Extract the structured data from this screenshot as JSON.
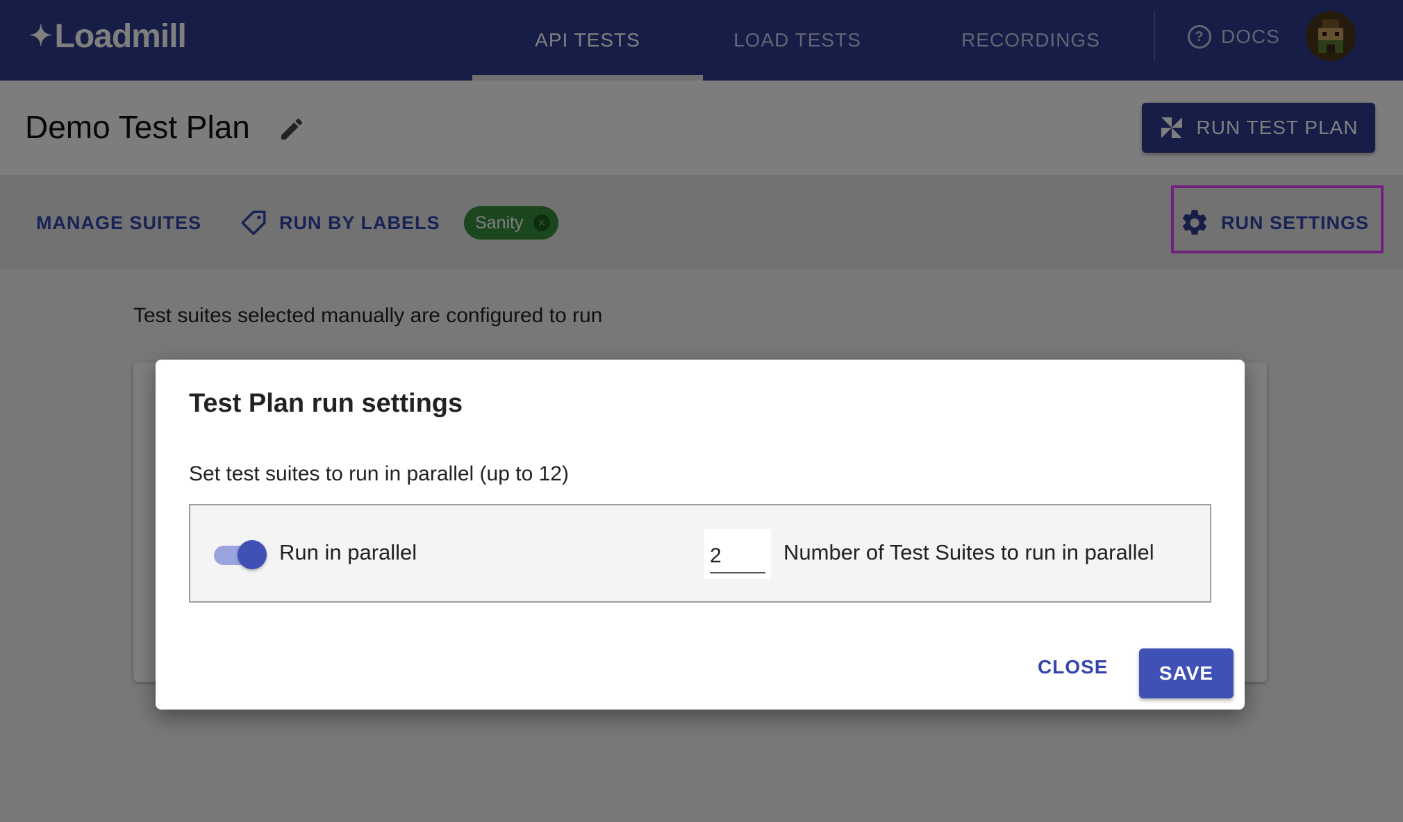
{
  "app": {
    "logo_text": "Loadmill"
  },
  "nav": {
    "tabs": [
      {
        "label": "API TESTS",
        "active": true
      },
      {
        "label": "LOAD TESTS",
        "active": false
      },
      {
        "label": "RECORDINGS",
        "active": false
      }
    ],
    "docs_label": "DOCS"
  },
  "page": {
    "title": "Demo Test Plan",
    "run_test_plan_label": "RUN TEST PLAN"
  },
  "toolbar": {
    "manage_suites_label": "MANAGE SUITES",
    "run_by_labels_label": "RUN BY LABELS",
    "label_chip": "Sanity",
    "run_settings_label": "RUN SETTINGS"
  },
  "body": {
    "info_text": "Test suites selected manually are configured to run"
  },
  "dialog": {
    "title": "Test Plan run settings",
    "subtitle": "Set test suites to run in parallel (up to 12)",
    "toggle_label": "Run in parallel",
    "toggle_on": true,
    "parallel_count": "2",
    "count_label": "Number of Test Suites to run in parallel",
    "close_label": "CLOSE",
    "save_label": "SAVE"
  },
  "colors": {
    "brand": "#2d3a8c",
    "accent": "#3f51b5",
    "chip": "#388e3c",
    "highlight": "#e040fb"
  }
}
